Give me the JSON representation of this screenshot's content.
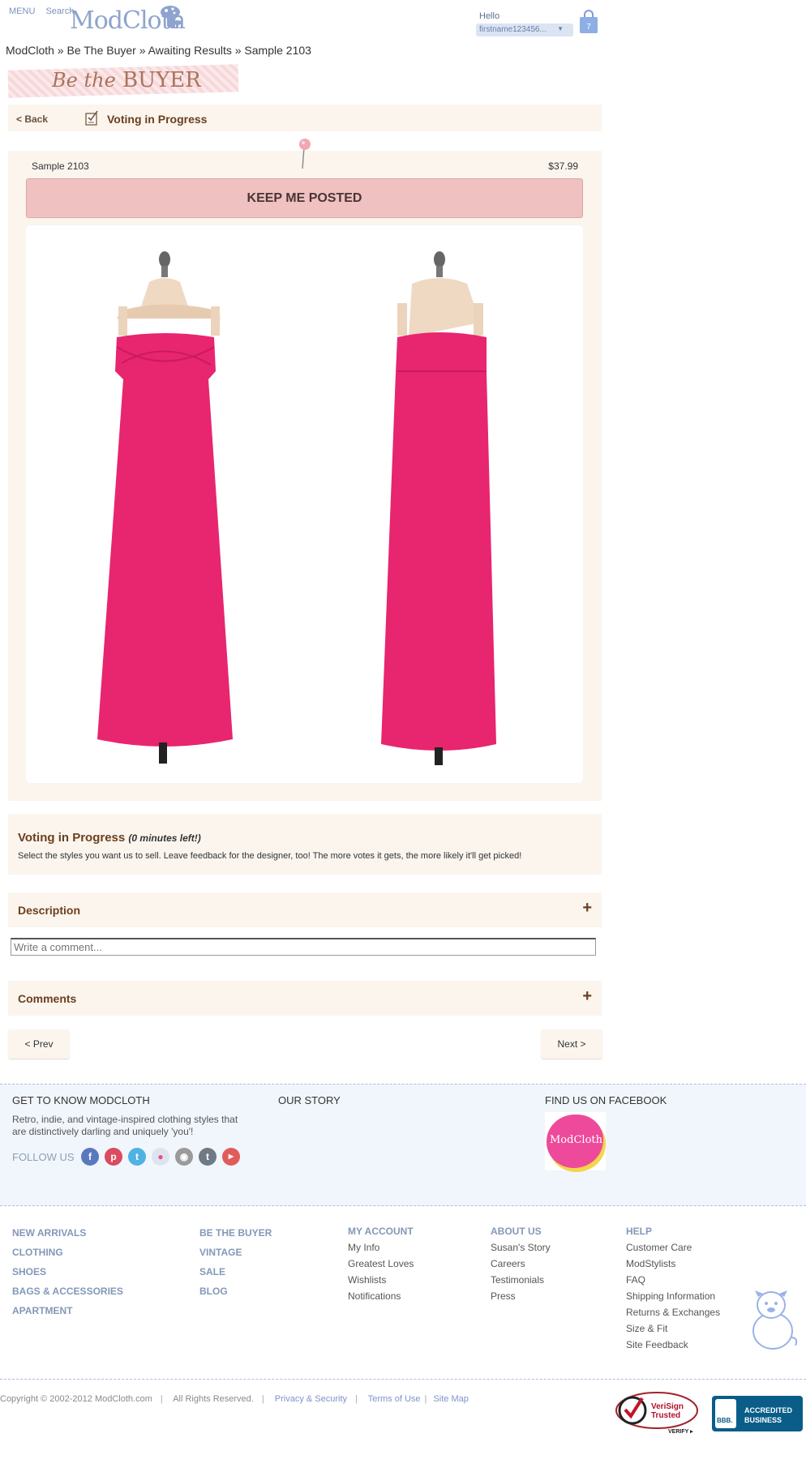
{
  "header": {
    "menu_label": "MENU",
    "search_label": "Search",
    "logo_text": "ModCloth",
    "hello": "Hello",
    "username": "firstname123456...",
    "bag_count": "7"
  },
  "breadcrumb": "ModCloth » Be The Buyer » Awaiting Results » Sample 2103",
  "banner": {
    "pre": "Be the",
    "main": "BUYER"
  },
  "status_bar": {
    "back": "< Back",
    "title": "Voting in Progress"
  },
  "sample": {
    "name": "Sample 2103",
    "price": "$37.99",
    "keep_posted": "KEEP ME POSTED",
    "dress_color": "#e8256f"
  },
  "voting": {
    "title": "Voting in Progress",
    "time_left": "(0 minutes left!)",
    "description": "Select the styles you want us to sell. Leave feedback for the designer, too! The more votes it gets, the more likely it'll get picked!"
  },
  "description_label": "Description",
  "comment_placeholder": "Write a comment...",
  "comments_label": "Comments",
  "pager": {
    "prev": "< Prev",
    "next": "Next >"
  },
  "footer": {
    "get_to_know": "GET TO KNOW MODCLOTH",
    "tagline": "Retro, indie, and vintage-inspired clothing styles that are distinctively darling and uniquely 'you'!",
    "follow_us": "FOLLOW US",
    "our_story": "OUR STORY",
    "facebook": "FIND US ON FACEBOOK",
    "facebook_logo_text": "ModCloth",
    "categories_col1": [
      "NEW ARRIVALS",
      "CLOTHING",
      "SHOES",
      "BAGS & ACCESSORIES",
      "APARTMENT"
    ],
    "categories_col2": [
      "BE THE BUYER",
      "VINTAGE",
      "SALE",
      "BLOG"
    ],
    "my_account": {
      "title": "MY ACCOUNT",
      "links": [
        "My Info",
        "Greatest Loves",
        "Wishlists",
        "Notifications"
      ]
    },
    "about_us": {
      "title": "ABOUT US",
      "links": [
        "Susan's Story",
        "Careers",
        "Testimonials",
        "Press"
      ]
    },
    "help": {
      "title": "HELP",
      "links": [
        "Customer Care",
        "ModStylists",
        "FAQ",
        "Shipping Information",
        "Returns & Exchanges",
        "Size & Fit",
        "Site Feedback"
      ]
    },
    "copyright": "Copyright © 2002-2012 ModCloth.com",
    "rights": "All Rights Reserved.",
    "privacy": "Privacy & Security",
    "terms": "Terms of Use",
    "sitemap": "Site Map",
    "verisign_line1": "VeriSign",
    "verisign_line2": "Trusted",
    "verisign_verify": "VERIFY ▸",
    "bbb_line1": "ACCREDITED",
    "bbb_line2": "BUSINESS",
    "bbb_logo": "BBB."
  },
  "colors": {
    "accent_brown": "#6b3f1d",
    "panel_beige": "#fbf5ee",
    "keep_pink": "#efc1c1",
    "footer_blue": "#8398b8"
  },
  "icons": [
    "mushroom-logo-icon",
    "shopping-bag-icon",
    "voting-checklist-icon",
    "push-pin-icon",
    "plus-icon",
    "facebook-icon",
    "pinterest-icon",
    "twitter-icon",
    "flickr-icon",
    "instagram-icon",
    "tumblr-icon",
    "youtube-icon",
    "pug-mascot-icon"
  ]
}
